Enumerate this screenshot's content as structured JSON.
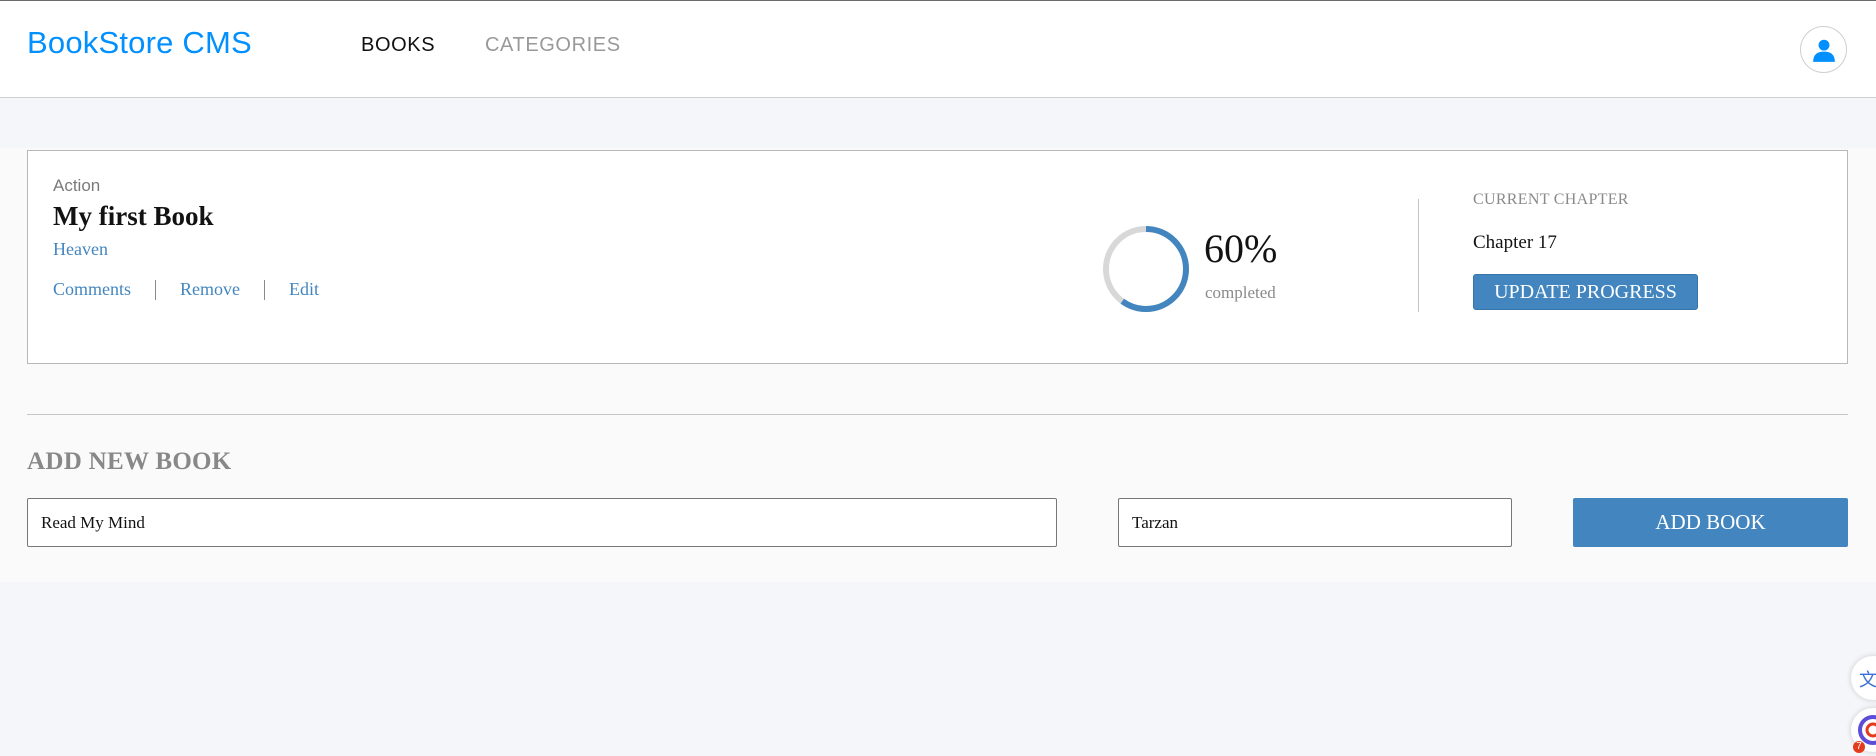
{
  "app": {
    "logo": "BookStore CMS"
  },
  "nav": {
    "books": "BOOKS",
    "categories": "CATEGORIES"
  },
  "header": {
    "user_icon": "user-icon"
  },
  "book": {
    "genre": "Action",
    "title": "My first Book",
    "author": "Heaven",
    "actions": [
      "Comments",
      "Remove",
      "Edit"
    ],
    "progress": {
      "percent_value": 0.6,
      "percent": "60%",
      "label": "completed"
    },
    "current_chapter_label": "CURRENT CHAPTER",
    "current_chapter": "Chapter 17",
    "update_button": "UPDATE PROGRESS"
  },
  "add_form": {
    "heading": "ADD NEW BOOK",
    "title_value": "Read My Mind",
    "category_value": "Tarzan",
    "submit": "ADD BOOK"
  },
  "floating": {
    "translate_glyph": "文",
    "badge": "7"
  },
  "colors": {
    "brand": "#0290ff",
    "accent": "#4386bf",
    "ring_track": "#d8d8d8"
  }
}
